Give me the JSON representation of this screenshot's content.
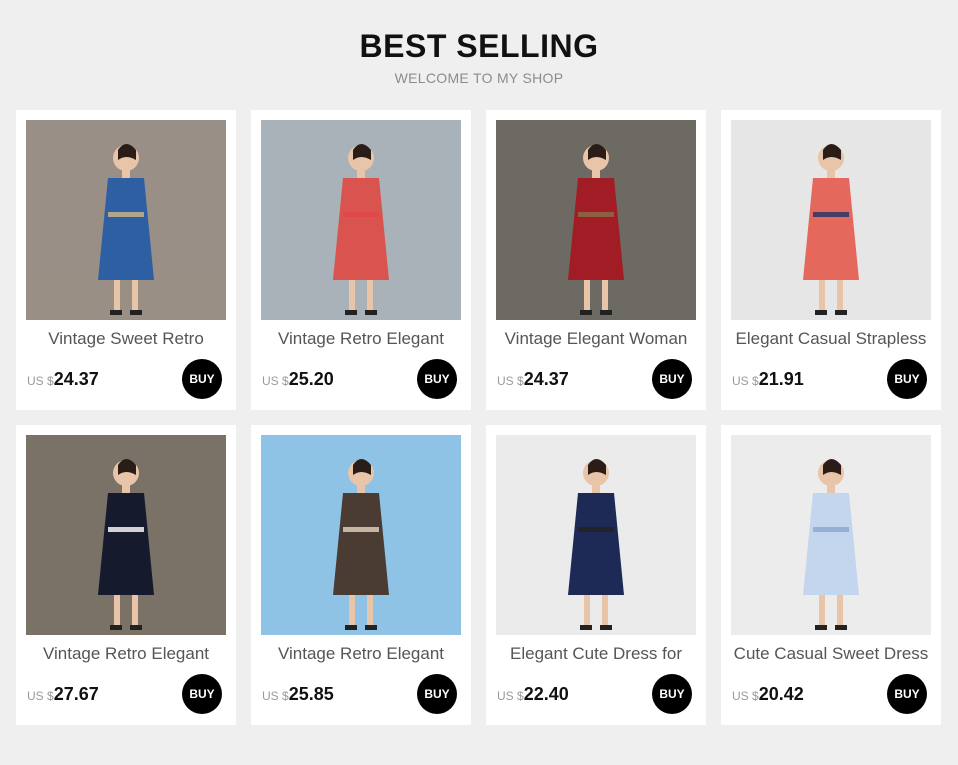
{
  "header": {
    "title": "BEST SELLING",
    "subtitle": "WELCOME TO MY SHOP"
  },
  "currency": "US $",
  "buy_label": "BUY",
  "products": [
    {
      "name": "Vintage Sweet Retro",
      "price": "24.37",
      "photo": "woman-in-blue-dress-with-straw-hat-photo",
      "colors": {
        "bg": "#9a8f86",
        "dress": "#2f5fa3",
        "accent": "#c9b18a"
      }
    },
    {
      "name": "Vintage Retro Elegant",
      "price": "25.20",
      "photo": "woman-in-red-striped-dress-by-car-photo",
      "colors": {
        "bg": "#a8b2b8",
        "dress": "#d9544f",
        "accent": "#e0484a"
      }
    },
    {
      "name": "Vintage Elegant Woman",
      "price": "24.37",
      "photo": "woman-in-red-slit-dress-sitting-photo",
      "colors": {
        "bg": "#6c6a62",
        "dress": "#a11c24",
        "accent": "#8a6a44"
      }
    },
    {
      "name": "Elegant Casual Strapless",
      "price": "21.91",
      "photo": "woman-in-striped-jumpsuit-photo",
      "colors": {
        "bg": "#e6e6e6",
        "dress": "#e5685c",
        "accent": "#2c3566"
      }
    },
    {
      "name": "Vintage Retro Elegant",
      "price": "27.67",
      "photo": "woman-in-black-tweed-vest-dress-photo",
      "colors": {
        "bg": "#7a7167",
        "dress": "#151a2c",
        "accent": "#f4f4f4"
      }
    },
    {
      "name": "Vintage Retro Elegant",
      "price": "25.85",
      "photo": "woman-in-plaid-dress-on-beach-photo",
      "colors": {
        "bg": "#8fc3e6",
        "dress": "#4a3b33",
        "accent": "#d9cdb7"
      }
    },
    {
      "name": "Elegant Cute Dress for",
      "price": "22.40",
      "photo": "woman-in-navy-midi-dress-photo",
      "colors": {
        "bg": "#ebebec",
        "dress": "#1d2a55",
        "accent": "#222222"
      }
    },
    {
      "name": "Cute Casual Sweet Dress",
      "price": "20.42",
      "photo": "woman-in-light-blue-floral-dress-photo",
      "colors": {
        "bg": "#ececec",
        "dress": "#c4d6ee",
        "accent": "#8fa8cf"
      }
    }
  ]
}
